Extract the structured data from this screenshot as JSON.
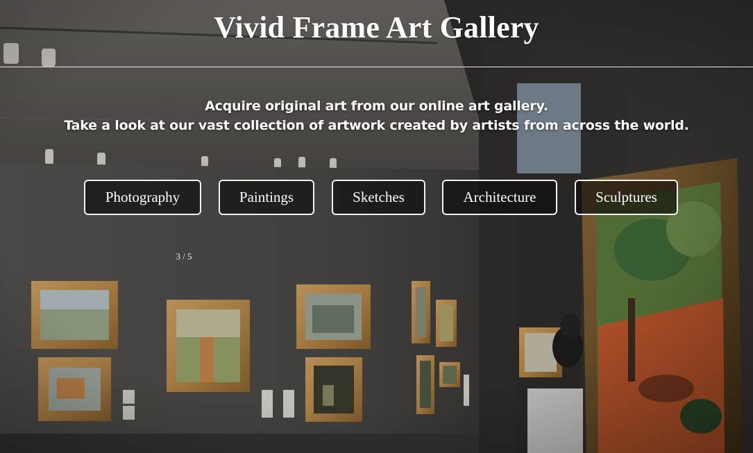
{
  "site": {
    "title": "Vivid Frame Art Gallery"
  },
  "tagline": {
    "line1": "Acquire original art from our online art gallery.",
    "line2": "Take a look at our vast collection of artwork created by artists from across the world."
  },
  "categories": [
    {
      "label": "Photography"
    },
    {
      "label": "Paintings"
    },
    {
      "label": "Sketches"
    },
    {
      "label": "Architecture"
    },
    {
      "label": "Sculptures"
    }
  ],
  "slideshow": {
    "counter": "3 / 5",
    "current": 3,
    "total": 5,
    "background_image": "gallery-room-photo"
  },
  "colors": {
    "text": "#ffffff",
    "button_border": "#f4f2f0",
    "wall": "#5a5654"
  }
}
